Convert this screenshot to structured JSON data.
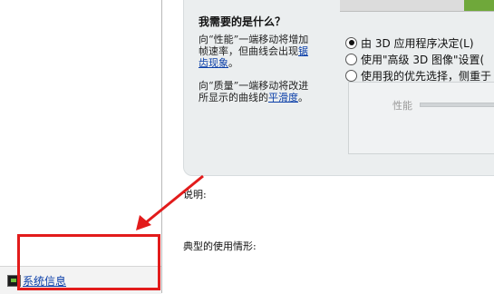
{
  "sidebar": {
    "system_info_link": "系统信息"
  },
  "help": {
    "title": "我需要的是什么？",
    "performance_text_prefix": "向“性能”一端移动将增加帧速率，但曲线会出现",
    "performance_link": "锯齿现象",
    "performance_text_suffix": "。",
    "quality_text_prefix": "向“质量”一端移动将改进所显示的曲线的",
    "quality_link": "平滑度",
    "quality_text_suffix": "。"
  },
  "options": {
    "radio_app_decide": "由 3D 应用程序决定(L)",
    "radio_advanced": "使用\"高级 3D 图像\"设置(",
    "radio_my_preference": "使用我的优先选择，侧重于",
    "selected_index": 0
  },
  "slider": {
    "performance_label": "性能"
  },
  "details": {
    "description_label": "说明:",
    "typical_usage_label": "典型的使用情形:"
  },
  "annotation": {
    "highlight_color": "#e21b1b"
  }
}
